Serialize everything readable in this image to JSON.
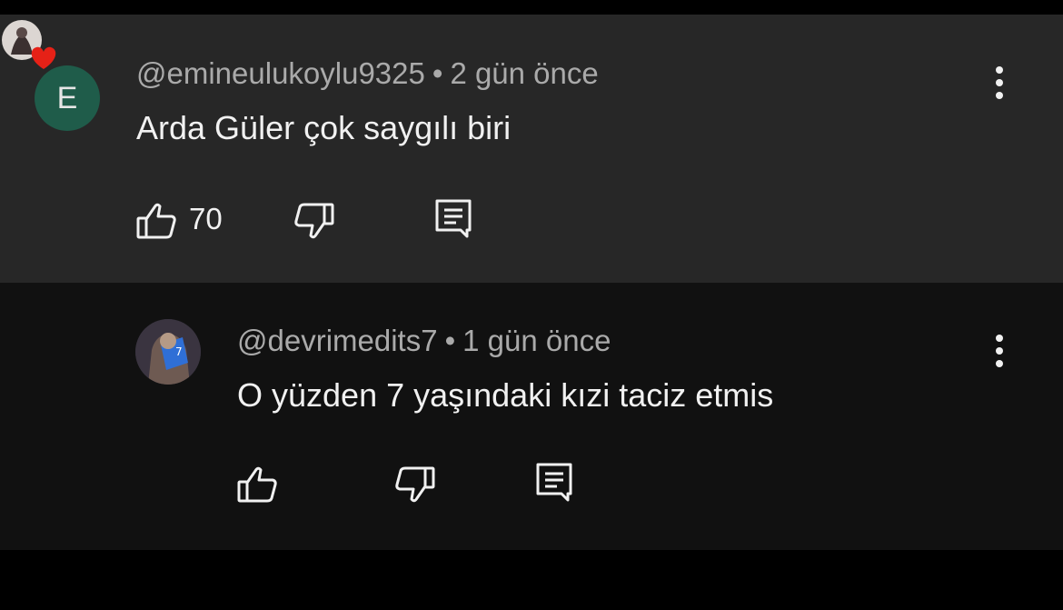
{
  "comments": [
    {
      "avatar_letter": "E",
      "author": "@emineulukoylu9325",
      "separator": "•",
      "time": "2 gün önce",
      "text": "Arda Güler çok saygılı biri",
      "likes": "70",
      "creator_hearted": true
    },
    {
      "author": "@devrimedits7",
      "separator": "•",
      "time": "1 gün önce",
      "text": "O yüzden 7 yaşındaki kızi taciz etmis",
      "avatar_number": "7"
    }
  ],
  "colors": {
    "comment_bg": "#272727",
    "reply_bg": "#111111",
    "avatar_bg": "#1f5c4a",
    "heart": "#e62117",
    "muted_text": "#aaaaaa",
    "text": "#f1f1f1"
  },
  "icons": [
    "like-icon",
    "dislike-icon",
    "reply-icon",
    "more-options-icon",
    "creator-heart-icon"
  ]
}
